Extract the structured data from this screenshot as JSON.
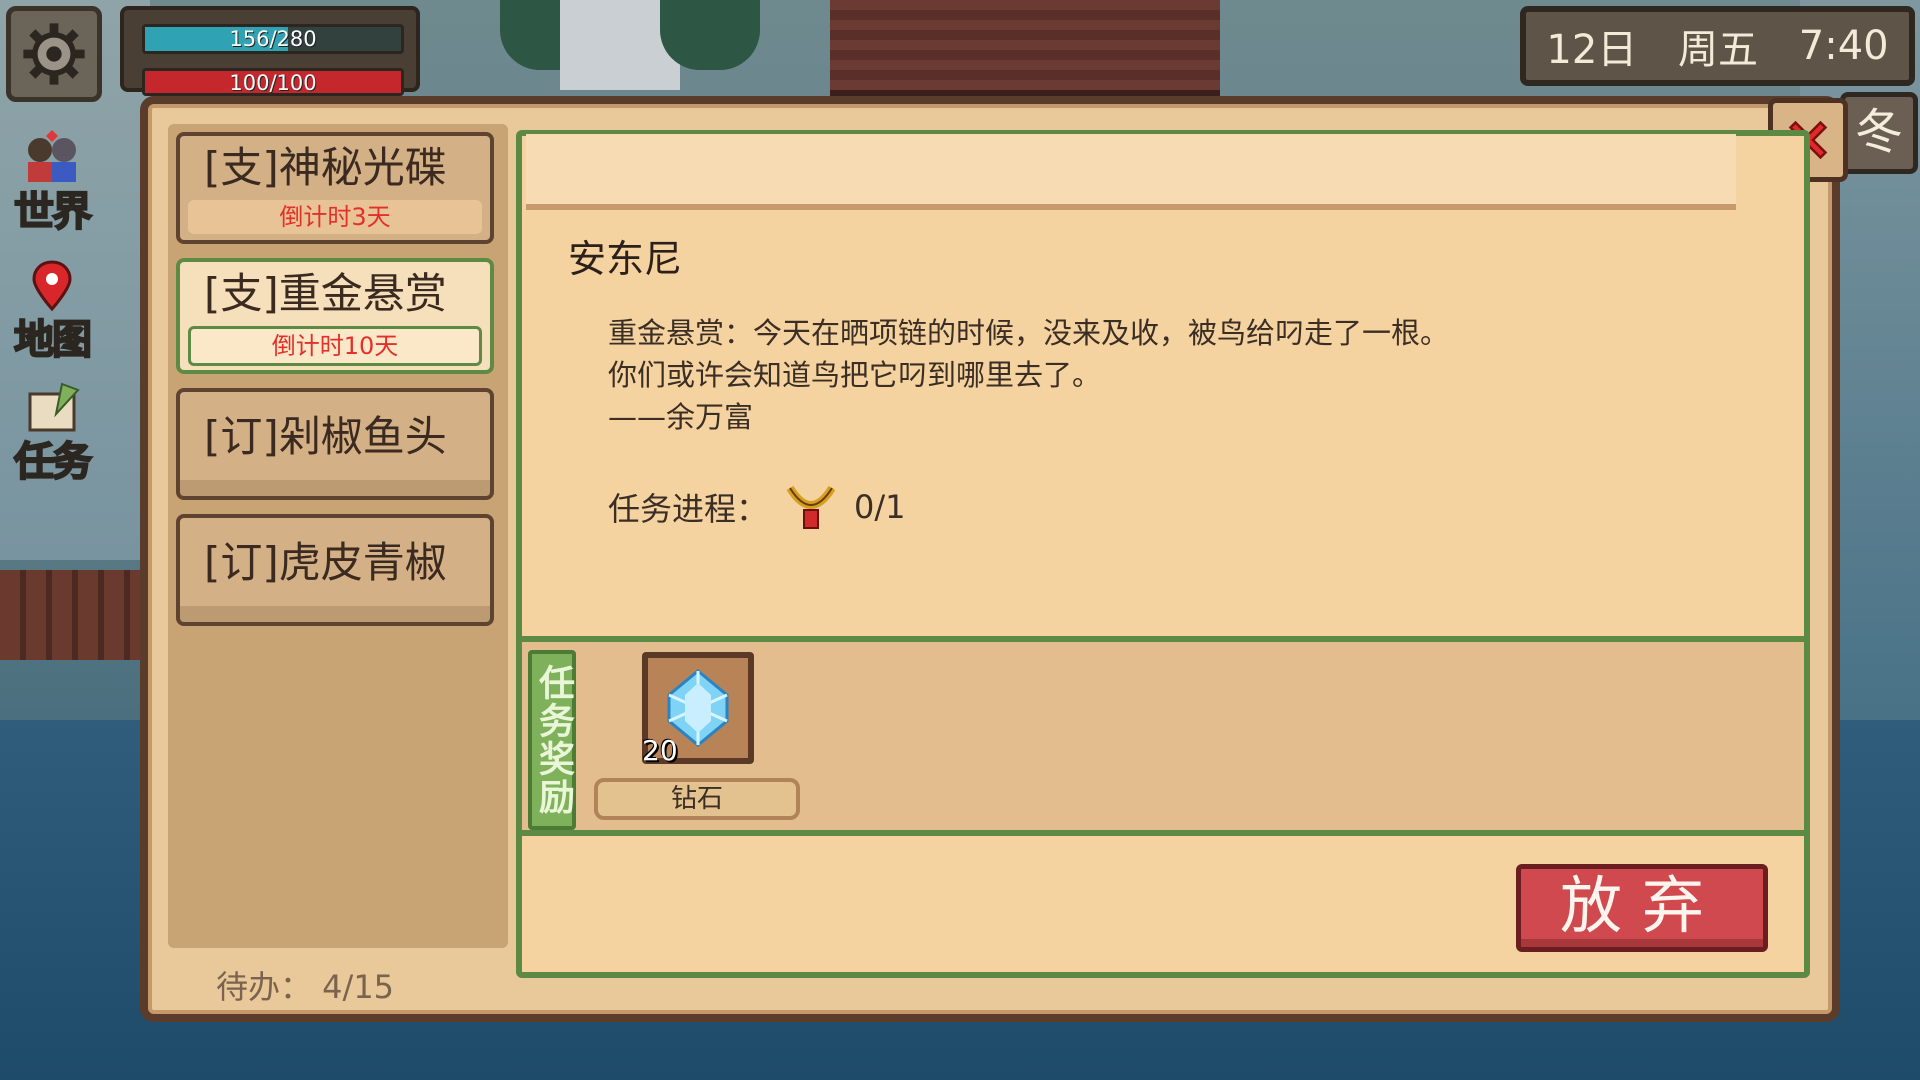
{
  "hud": {
    "energy_text": "156/280",
    "energy_fraction": 0.557,
    "hp_text": "100/100",
    "hp_fraction": 1.0,
    "day": "12日",
    "weekday": "周五",
    "time": "7:40",
    "season": "冬"
  },
  "side_menu": {
    "world_label": "世界",
    "map_label": "地图",
    "task_label": "任务"
  },
  "quests": [
    {
      "name": "[支]神秘光碟",
      "timer": "倒计时3天",
      "selected": false
    },
    {
      "name": "[支]重金悬赏",
      "timer": "倒计时10天",
      "selected": true
    },
    {
      "name": "[订]剁椒鱼头",
      "timer": "",
      "selected": false
    },
    {
      "name": "[订]虎皮青椒",
      "timer": "",
      "selected": false
    }
  ],
  "todo": "待办：  4/15",
  "detail": {
    "npc_name": "安东尼",
    "description": [
      "重金悬赏：今天在晒项链的时候，没来及收，被鸟给叼走了一根。",
      "你们或许会知道鸟把它叼到哪里去了。",
      "——余万富"
    ],
    "progress_label": "任务进程：",
    "progress_value": "0/1",
    "progress_icon": "necklace-icon",
    "reward_label": "任务奖励",
    "rewards": [
      {
        "name": "钻石",
        "count": "20",
        "icon": "diamond-icon"
      }
    ],
    "abandon_label": "放弃"
  },
  "colors": {
    "panel": "#f5d3a1",
    "border_green": "#5e8b44",
    "timer_red": "#e3302b",
    "abandon_red": "#d0494e"
  }
}
